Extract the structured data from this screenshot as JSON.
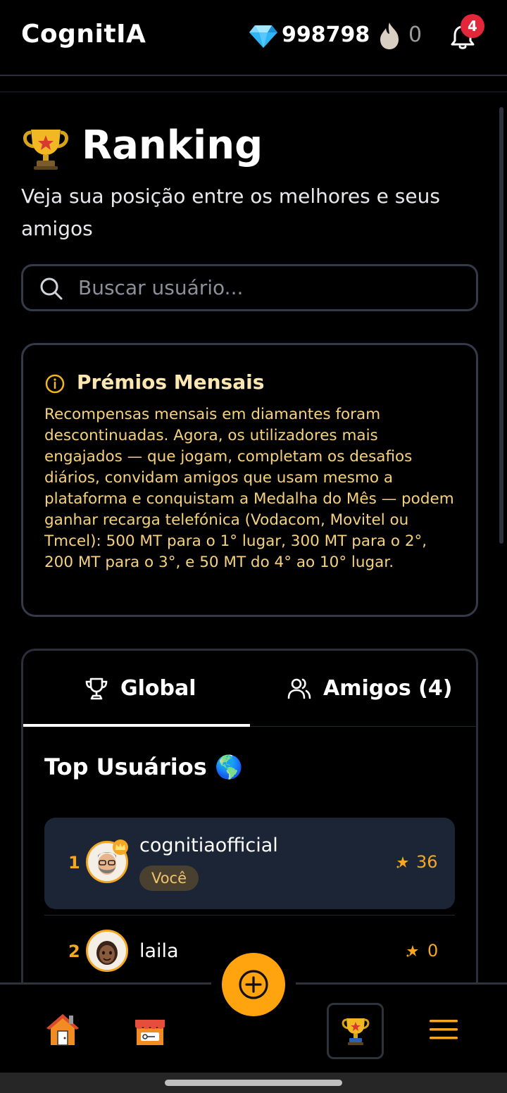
{
  "header": {
    "app_title": "CognitIA",
    "diamonds": "998798",
    "streak": "0",
    "notifications": "4",
    "icons": [
      "diamond-icon",
      "flame-icon",
      "bell-icon"
    ]
  },
  "page": {
    "title": "Ranking",
    "subtitle": "Veja sua posição entre os melhores e seus amigos"
  },
  "search": {
    "placeholder": "Buscar usuário..."
  },
  "prizes": {
    "title": "Prémios Mensais",
    "text": "Recompensas mensais em diamantes foram descontinuadas. Agora, os utilizadores mais engajados — que jogam, completam os desafios diários, convidam amigos que usam mesmo a plataforma e conquistam a Medalha do Mês — podem ganhar recarga telefónica (Vodacom, Movitel ou Tmcel): 500 MT para o 1° lugar, 300 MT para o 2°, 200 MT para o 3°, e 50 MT do 4° ao 10° lugar."
  },
  "tabs": [
    {
      "label": "Global",
      "active": true
    },
    {
      "label": "Amigos (4)",
      "active": false
    }
  ],
  "ranking": {
    "section_title": "Top Usuários 🌎",
    "you_label": "Você",
    "users": [
      {
        "rank": "1",
        "name": "cognitiaofficial",
        "points": "36",
        "is_you": true
      },
      {
        "rank": "2",
        "name": "laila",
        "points": "0",
        "is_you": false
      }
    ]
  },
  "bottom_nav": {
    "items": [
      "home-icon",
      "shop-icon",
      "add-icon",
      "ranking-icon",
      "menu-icon"
    ],
    "active": "ranking-icon"
  },
  "colors": {
    "accent": "#ffa30f",
    "rank_orange": "#f5a623",
    "highlight_row": "#1c2535",
    "prize_text": "#f6d27e",
    "badge_red": "#e2273b"
  }
}
